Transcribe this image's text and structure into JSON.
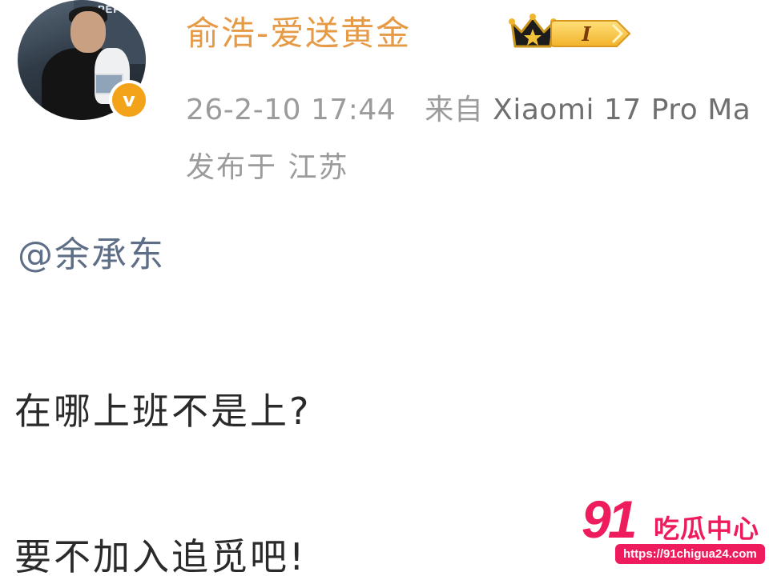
{
  "post": {
    "author": {
      "username": "俞浩-爱送黄金",
      "avatar_sign_text": "PEPP",
      "verified_badge": "v",
      "vip_level": "I"
    },
    "timestamp": "26-2-10 17:44",
    "source_prefix": "来自",
    "device": "Xiaomi 17 Pro Ma",
    "location": "发布于 江苏",
    "mention": "@余承东",
    "lines": [
      "在哪上班不是上?",
      "要不加入追觅吧!"
    ]
  },
  "watermark": {
    "number": "91",
    "text": "吃瓜中心",
    "url": "https://91chigua24.com"
  },
  "colors": {
    "username": "#e69a45",
    "meta": "#9b9b9b",
    "mention": "#5e6e86",
    "body_text": "#2a2a2a",
    "badge": "#f3a31a",
    "watermark": "#ee1c5c"
  }
}
